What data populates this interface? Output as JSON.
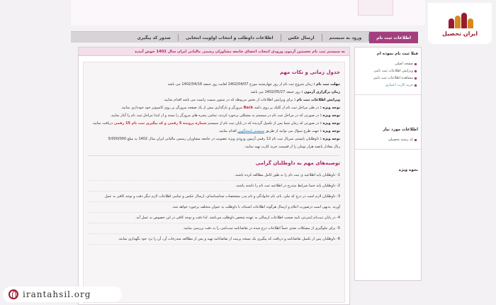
{
  "brand": {
    "name": "ایران تحصیل",
    "colors": {
      "primary": "#9a1b2d",
      "accent": "#a33f7f"
    }
  },
  "nav": {
    "items": [
      {
        "label": "اطلاعات ثبت نام",
        "active": true
      },
      {
        "label": "ورود به سیستم",
        "active": false
      },
      {
        "label": "ارسال عکس",
        "active": false
      },
      {
        "label": "اطلاعات داوطلب و انتخاب اولویت انتخابی",
        "active": false
      },
      {
        "label": "صدور کد پیگیری",
        "active": false
      }
    ]
  },
  "sidebar": {
    "box1": {
      "title": "قبلا ثبت نام نموده ام",
      "links": [
        "صفحه اصلی",
        "ویرایش اطلاعات ثبت نامی",
        "مشاهده اطلاعات ثبت نامی",
        "خرید کارت اعتباری"
      ]
    },
    "box2": {
      "title": "اطلاعات مورد نیاز",
      "links": [
        "کد رشته تحصیلی"
      ]
    },
    "box3": {
      "title": "نحوه ویژه"
    }
  },
  "main": {
    "alert": "به سیستم ثبت نام نخستین آزمون ورودی انتخاب اعضای جامعه مشاوران رسمی مالیاتی ایران سال 1402 خوش آمدید",
    "schedule_title": "جدول زمانی و نکات مهم",
    "schedule": [
      {
        "label": "مهلت ثبت نام :",
        "text": "زمان شروع ثبت نام از روز چهارشنبه مورخ 1402/04/07 لغایت روز جمعه 1402/04/16 می باشد"
      },
      {
        "label": "زمان برگزاری آزمون :",
        "text": "روز جمعه 1402/05/27 می باشد"
      },
      {
        "label": "ویرایش اطلاعات ثبت نام :",
        "text": "برای ویرایش اطلاعات از بخش مربوطه که در ستون سمت راست می باشد اقدام نمایید."
      },
      {
        "label": "توجه ویژه :",
        "text": "در طی مراحل ثبت نام از کلیک بر روی دکمه",
        "red": "Back",
        "text2": "مرورگر و بارگذاری بیش از یک صفحه مرورگر بر روی کامپیوتر خود خودداری نمایید."
      },
      {
        "label": "توجه ویژه :",
        "text": "در صورتی که در مراحل ثبت نام در سیستم به مشکلی برخورد کردید، تمامی پنجره های مرورگر را بسته و از ابتدا مراحل ثبت نام را آغاز نمایید."
      },
      {
        "label": "توجه ویژه :",
        "text": "در صورتی که زمان شما پس از تکمیل گردیده که در پایان ثبت نام از سیستم",
        "red": "شماره پرونده 5 رقمی و کد پیگیری ثبت نام 15 رقمی",
        "text2": "دریافت نمایید."
      },
      {
        "label": "توجه ویژه :",
        "text": "جهت طرح سوال می توانید از طریق",
        "link": "سیستم پاسخگویی",
        "text2": "اقدام نمایید."
      },
      {
        "label": "توجه ویژه :",
        "text": "داوطلبان بایستی سریال ثبت نام 12 رقمی آزمون ورودی ویژه عضویت در جامعه مشاوران رسمی مالیاتی ایران سال 1402 به مبلغ 5/000/000"
      },
      {
        "label": "",
        "text": "ریال معادل پانصد هزار تومان را از قسمت خرید کارت تهیه نمایید."
      }
    ],
    "tips_title": "توصیه‌های مهم به داوطلبان گرامی",
    "tips": [
      "1- داوطلبان باید اطلاعیه ی ثبت نام را به طور کامل مطالعه کرده باشند.",
      "2- داوطلبان باید حتما شرایط مندرج در اطلاعیه ثبت نام را داشته باشند.",
      "3- داوطلبان لازم است در درج کد ملی، نام، نام خانوادگی و نام پدر، مشخصات شناسنامه‌ای، ارسال عکس و تمامی اطلاعات لازم دیگر دقت و توجه کافی به عمل",
      "آورند. بدیهی است درصورت اعلام و ارسال هرگونه اطلاعات اشتباه، با داوطلب به عنوان متخلف برخورد خواهد شد.",
      "4- در پایان ثبت‌نام اینترنتی تایید صحت اطلاعات ارسالی به عهده شخص داوطلب می‌باشد. لذا دقت و توجه کافی در این خصوص به عمل آید.",
      "5- برای جلوگیری از مشکلات بعدی حتماً اطلاعات درج شده در تقاضانامه ثبت‌نامی را به دقت بررسی نمایید.",
      "6- داوطلبان پس از تکمیل تقاضانامه و دریافت کد پیگیری یک نسخه پرینت از تقاضانامه تهیه و پس از مطالعه مندرجات آن، آن را نزد خود نگهداری نمایند."
    ]
  },
  "footer": {
    "url": "irantahsil.org"
  }
}
